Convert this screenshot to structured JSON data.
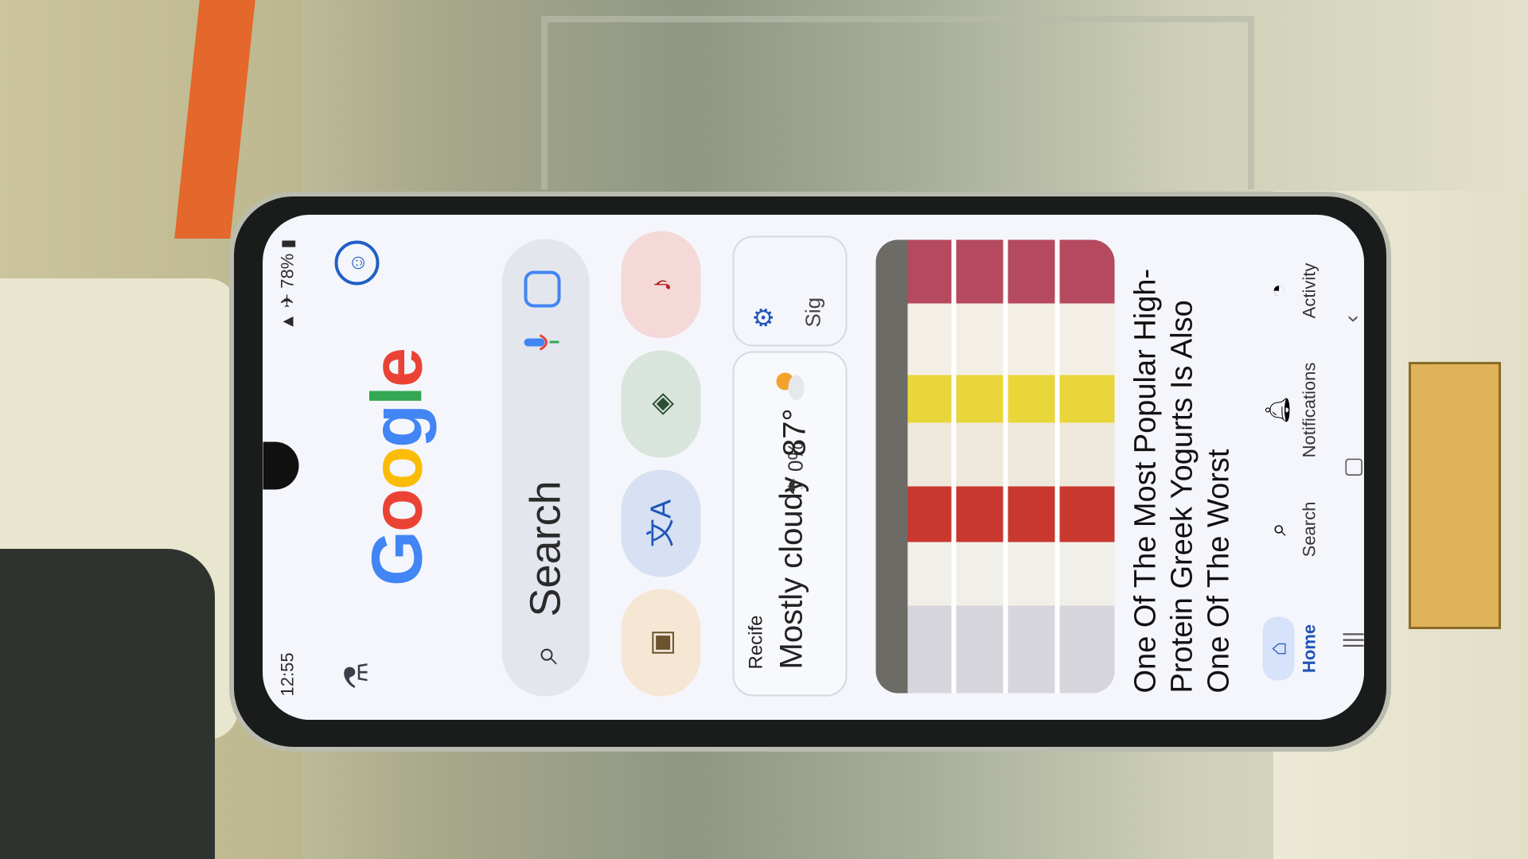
{
  "status": {
    "time": "12:55",
    "battery": "78%"
  },
  "search": {
    "logo_letters": [
      "G",
      "o",
      "o",
      "g",
      "l",
      "e"
    ],
    "placeholder": "Search"
  },
  "weather": {
    "location": "Recife",
    "condition": "Mostly cloudy",
    "rain": "0%",
    "temperature": "87°",
    "side_label": "Sig"
  },
  "news": {
    "title": "One Of The Most Popular High-Protein Greek Yogurts Is Also One Of The Worst"
  },
  "nav": {
    "home": "Home",
    "search": "Search",
    "notifications": "Notifications",
    "activity": "Activity"
  },
  "colors": {
    "g_blue": "#4285F4",
    "g_red": "#EA4335",
    "g_yellow": "#FBBC05",
    "g_green": "#34A853"
  }
}
